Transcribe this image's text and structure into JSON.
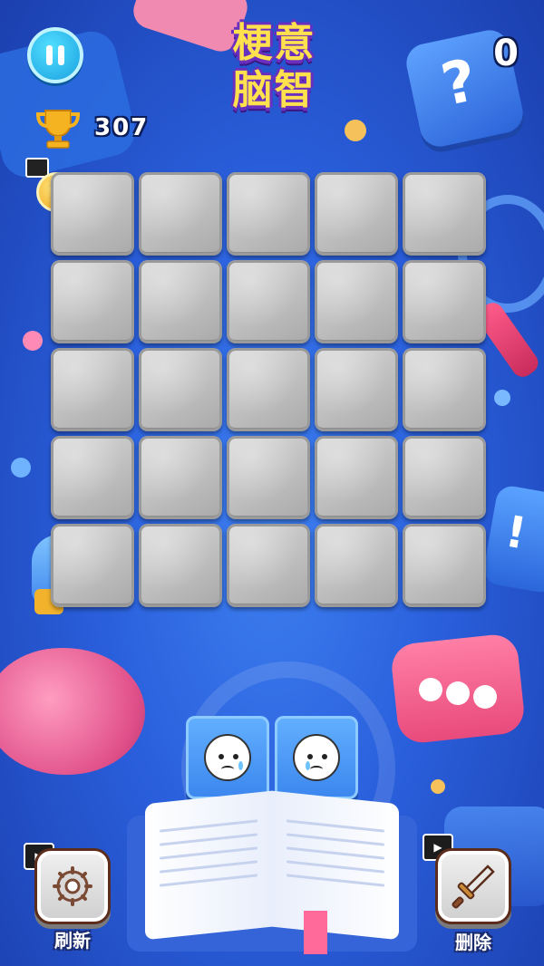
{
  "game": {
    "title_line1": "梗意",
    "title_line2": "脑智",
    "level": "0",
    "score": "307",
    "coins": "0"
  },
  "board": {
    "rows": 5,
    "cols": 5,
    "tile_state": "covered"
  },
  "hand": [
    {
      "icon": "worried-face-icon"
    },
    {
      "icon": "crying-face-icon"
    }
  ],
  "buttons": {
    "refresh_label": "刷新",
    "delete_label": "删除"
  },
  "colors": {
    "background": "#2a5fdc",
    "tile": "#c4c4c4",
    "hand_card": "#4a96f5",
    "title": "#ffe14d"
  }
}
